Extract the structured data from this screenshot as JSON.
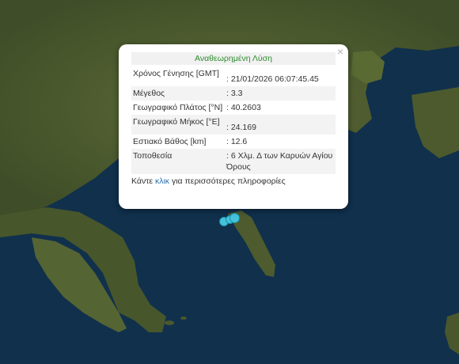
{
  "popup": {
    "title": "Αναθεωρημένη Λύση",
    "close_label": "×",
    "rows": [
      {
        "key": "Χρόνος Γένησης [GMT]",
        "value": ": 21/01/2026 06:07:45.45"
      },
      {
        "key": "Μέγεθος",
        "value": ": 3.3"
      },
      {
        "key": "Γεωγραφικό Πλάτος [°N]",
        "value": ": 40.2603"
      },
      {
        "key": "Γεωγραφικό Μήκος [°E]",
        "value": ": 24.169"
      },
      {
        "key": "Εστιακό Βάθος [km]",
        "value": ": 12.6"
      },
      {
        "key": "Τοποθεσία",
        "value": ": 6 Χλμ. Δ των Καρυών Αγίου Όρους"
      }
    ],
    "more_prefix": "Κάντε",
    "more_link": "κλικ",
    "more_suffix": "για περισσότερες πληροφορίες"
  },
  "colors": {
    "sea": "#0f2a44",
    "land": "#4a5a2c",
    "marker_fill": "#44c4dc",
    "title_text": "#2e8b2e",
    "link": "#2a6fb0"
  }
}
